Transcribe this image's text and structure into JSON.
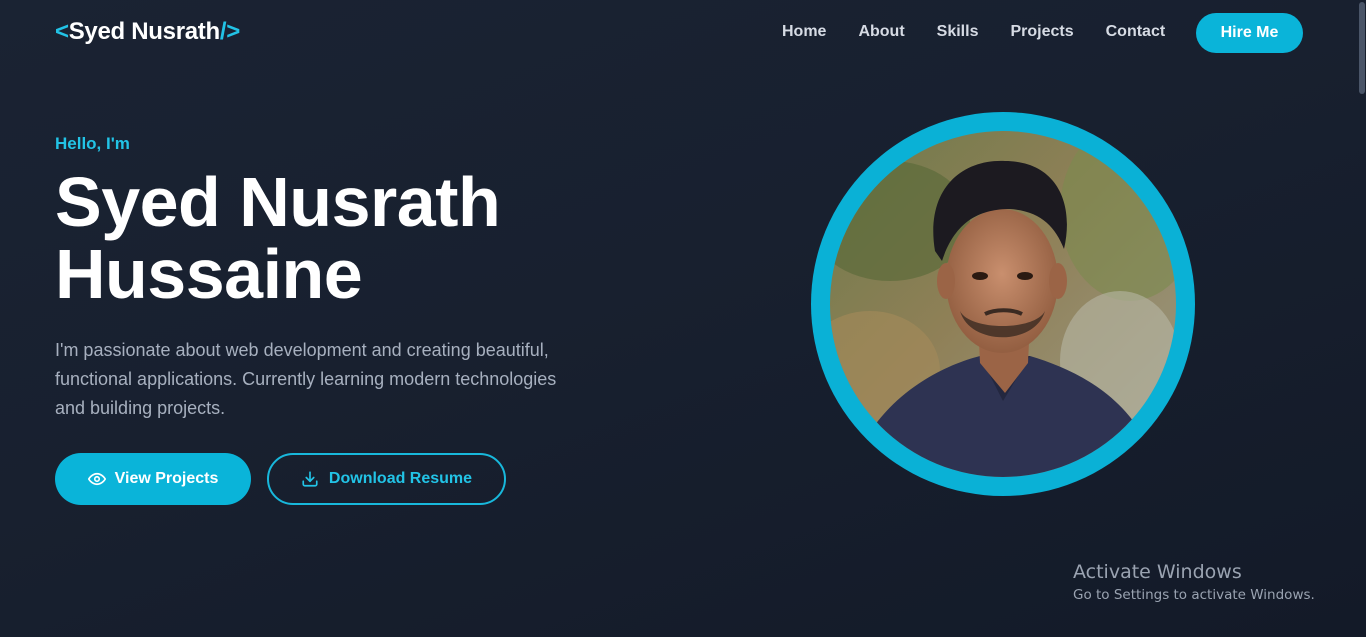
{
  "nav": {
    "logo_open": "<",
    "logo_name": "Syed Nusrath",
    "logo_close": "/>",
    "links": [
      "Home",
      "About",
      "Skills",
      "Projects",
      "Contact"
    ],
    "cta": "Hire Me"
  },
  "hero": {
    "greeting": "Hello, I'm",
    "title_line1": "Syed Nusrath",
    "title_line2": "Hussaine",
    "description": "I'm passionate about web development and creating beautiful, functional applications. Currently learning modern technologies and building projects.",
    "primary_button": "View Projects",
    "primary_icon": "eye-icon",
    "secondary_button": "Download Resume",
    "secondary_icon": "download-icon"
  },
  "overlay": {
    "activate_title": "Activate Windows",
    "activate_sub": "Go to Settings to activate Windows."
  },
  "colors": {
    "accent": "#0ab4d9",
    "background": "#18202f",
    "text_muted": "#a7b0bf"
  }
}
